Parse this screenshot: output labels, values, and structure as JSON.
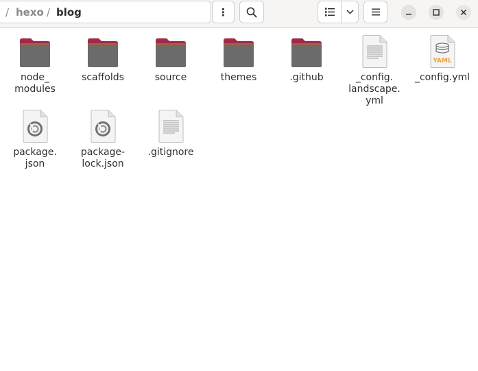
{
  "pathbar": {
    "separator": "/",
    "crumbs": [
      {
        "label": "hexo"
      },
      {
        "label": "blog"
      }
    ]
  },
  "toolbar": {
    "menu_glyph": "⋮",
    "search_icon": "search-icon",
    "view_icon": "list-view-icon",
    "view_dropdown_icon": "chevron-down-icon",
    "hamburger_icon": "hamburger-menu-icon",
    "minimize_icon": "minimize-icon",
    "maximize_icon": "maximize-icon",
    "close_icon": "close-icon"
  },
  "colors": {
    "folder_tab": "#a02a4a",
    "folder_body": "#6b6b6b",
    "yaml_accent": "#e8a33a"
  },
  "files": [
    {
      "label": "node_\nmodules",
      "icon": "folder-icon"
    },
    {
      "label": "scaffolds",
      "icon": "folder-icon"
    },
    {
      "label": "source",
      "icon": "folder-icon"
    },
    {
      "label": "themes",
      "icon": "folder-icon"
    },
    {
      "label": ".github",
      "icon": "folder-icon"
    },
    {
      "label": "_config.\nlandscape.\nyml",
      "icon": "text-file-icon"
    },
    {
      "label": "_config.yml",
      "icon": "yaml-file-icon",
      "badge": "YAML"
    },
    {
      "label": "package.\njson",
      "icon": "json-file-icon"
    },
    {
      "label": "package-\nlock.json",
      "icon": "json-file-icon"
    },
    {
      "label": ".gitignore",
      "icon": "text-file-icon"
    }
  ]
}
